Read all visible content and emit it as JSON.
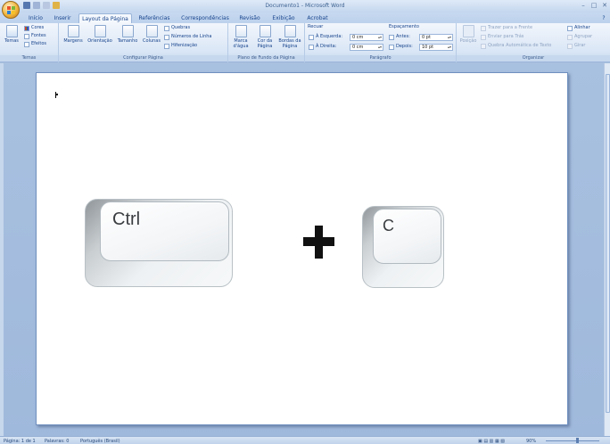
{
  "window": {
    "title": "Documento1 - Microsoft Word"
  },
  "tabs": [
    "Início",
    "Inserir",
    "Layout da Página",
    "Referências",
    "Correspondências",
    "Revisão",
    "Exibição",
    "Acrobat"
  ],
  "ribbon": {
    "temas": {
      "label": "Temas",
      "button": "Temas",
      "items": [
        "Cores",
        "Fontes",
        "Efeitos"
      ]
    },
    "configurar": {
      "label": "Configurar Página",
      "buttons": [
        "Margens",
        "Orientação",
        "Tamanho",
        "Colunas"
      ],
      "items": [
        "Quebras",
        "Números de Linha",
        "Hifenização"
      ]
    },
    "plano": {
      "label": "Plano de Fundo da Página",
      "buttons": [
        "Marca d'água",
        "Cor da Página",
        "Bordas da Página"
      ]
    },
    "paragrafo": {
      "label": "Parágrafo",
      "recuar": "Recuar",
      "espacamento": "Espaçamento",
      "esquerda_label": "À Esquerda:",
      "esquerda_value": "0 cm",
      "direita_label": "À Direita:",
      "direita_value": "0 cm",
      "antes_label": "Antes:",
      "antes_value": "0 pt",
      "depois_label": "Depois:",
      "depois_value": "10 pt"
    },
    "organizar": {
      "label": "Organizar",
      "posicao": "Posição",
      "items": [
        "Trazer para a Frente",
        "Enviar para Trás",
        "Quebra Automática de Texto"
      ],
      "right_items": [
        "Alinhar",
        "Agrupar",
        "Girar"
      ]
    }
  },
  "document": {
    "key1": "Ctrl",
    "key2": "C"
  },
  "status": {
    "page": "Página: 1 de 1",
    "words": "Palavras: 0",
    "language": "Português (Brasil)",
    "zoom": "90%"
  },
  "colors": {
    "ribbon": "#dbe7f6",
    "workspace": "#a9c1e0",
    "text": "#15428b"
  }
}
